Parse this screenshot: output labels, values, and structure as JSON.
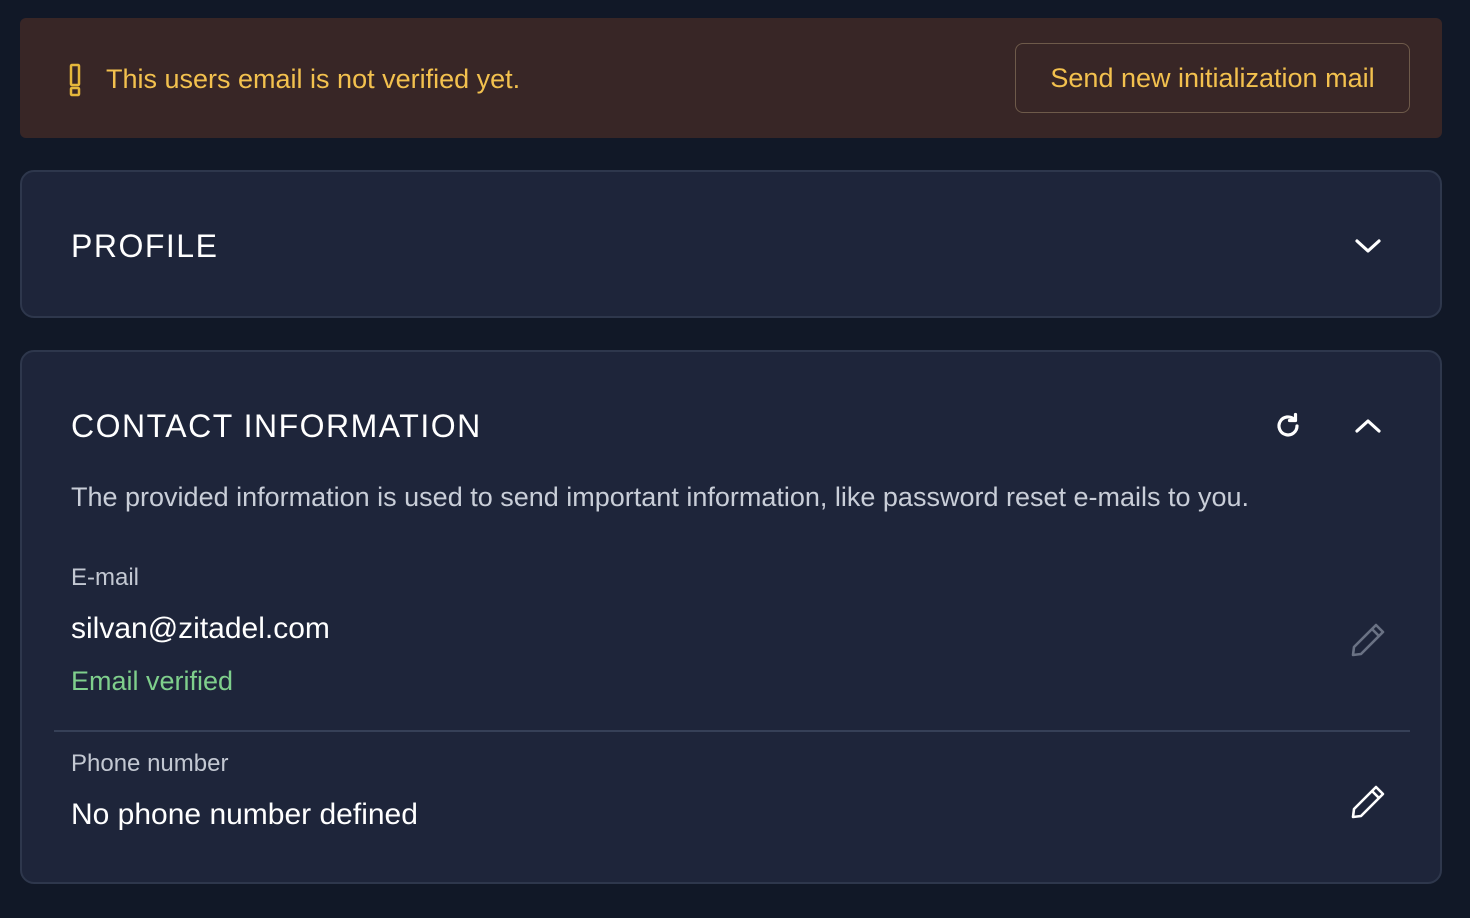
{
  "warning": {
    "icon": "exclamation-icon",
    "message": "This users email is not verified yet.",
    "button_label": "Send new initialization mail",
    "accent_color": "#f3c14e"
  },
  "profile": {
    "title": "PROFILE",
    "expand_icon": "chevron-down-icon"
  },
  "contact": {
    "title": "CONTACT INFORMATION",
    "refresh_icon": "refresh-icon",
    "collapse_icon": "chevron-up-icon",
    "description": "The provided information is used to send important information, like password reset e-mails to you.",
    "email": {
      "label": "E-mail",
      "value": "silvan@zitadel.com",
      "status": "Email verified",
      "status_color": "#7fcf8c",
      "edit_icon": "pencil-icon"
    },
    "phone": {
      "label": "Phone number",
      "value": "No phone number defined",
      "edit_icon": "pencil-icon"
    }
  }
}
